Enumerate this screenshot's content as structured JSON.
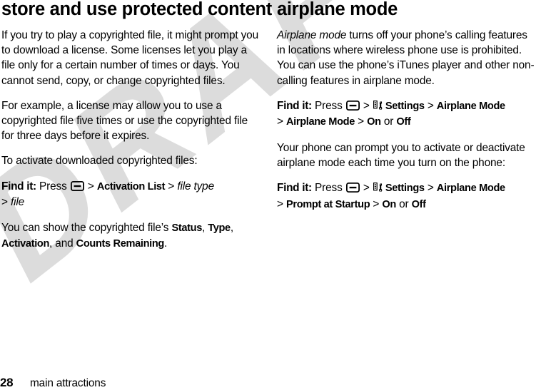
{
  "watermark": {
    "text": "DRAFT",
    "color": "#dcdcdc"
  },
  "left_column": {
    "heading": "store and use protected content",
    "paragraph_1": "If you try to play a copyrighted file, it might prompt you to download a license. Some licenses let you play a file only for a certain number of times or days. You cannot send, copy, or change copyrighted files.",
    "paragraph_2": "For example, a license may allow you to use a copyrighted file five times or use the copyrighted file for three days before it expires.",
    "paragraph_3": "To activate downloaded copyrighted files:",
    "find_it": {
      "label": "Find it:",
      "press": "Press",
      "key_icon": "menu-key-icon",
      "sep": ">",
      "step_1": "Activation List",
      "step_2": "file type",
      "step_3": "file"
    },
    "paragraph_4": {
      "lead": "You can show the copyrighted file’s ",
      "term_1": "Status",
      "comma_1": ", ",
      "term_2": "Type",
      "comma_2": ", ",
      "term_3": "Activation",
      "conj": ", and ",
      "term_4": "Counts Remaining",
      "period": "."
    }
  },
  "right_column": {
    "heading": "airplane mode",
    "paragraph_1": {
      "italic_lead": "Airplane mode",
      "rest": " turns off your phone’s calling features in locations where wireless phone use is prohibited. You can use the phone’s iTunes player and other non-calling features in airplane mode."
    },
    "find_it_1": {
      "label": "Find it:",
      "press": "Press",
      "key_icon": "menu-key-icon",
      "settings_icon": "settings-tools-icon",
      "sep": ">",
      "step_1": "Settings",
      "step_2": "Airplane Mode",
      "step_3": "Airplane Mode",
      "step_4": "On",
      "or": "or",
      "step_5": "Off"
    },
    "paragraph_2": "Your phone can prompt you to activate or deactivate airplane mode each time you turn on the phone:",
    "find_it_2": {
      "label": "Find it:",
      "press": "Press",
      "key_icon": "menu-key-icon",
      "settings_icon": "settings-tools-icon",
      "sep": ">",
      "step_1": "Settings",
      "step_2": "Airplane Mode",
      "step_3": "Prompt at Startup",
      "step_4": "On",
      "or": "or",
      "step_5": "Off"
    }
  },
  "footer": {
    "page_number": "28",
    "section": "main attractions"
  }
}
